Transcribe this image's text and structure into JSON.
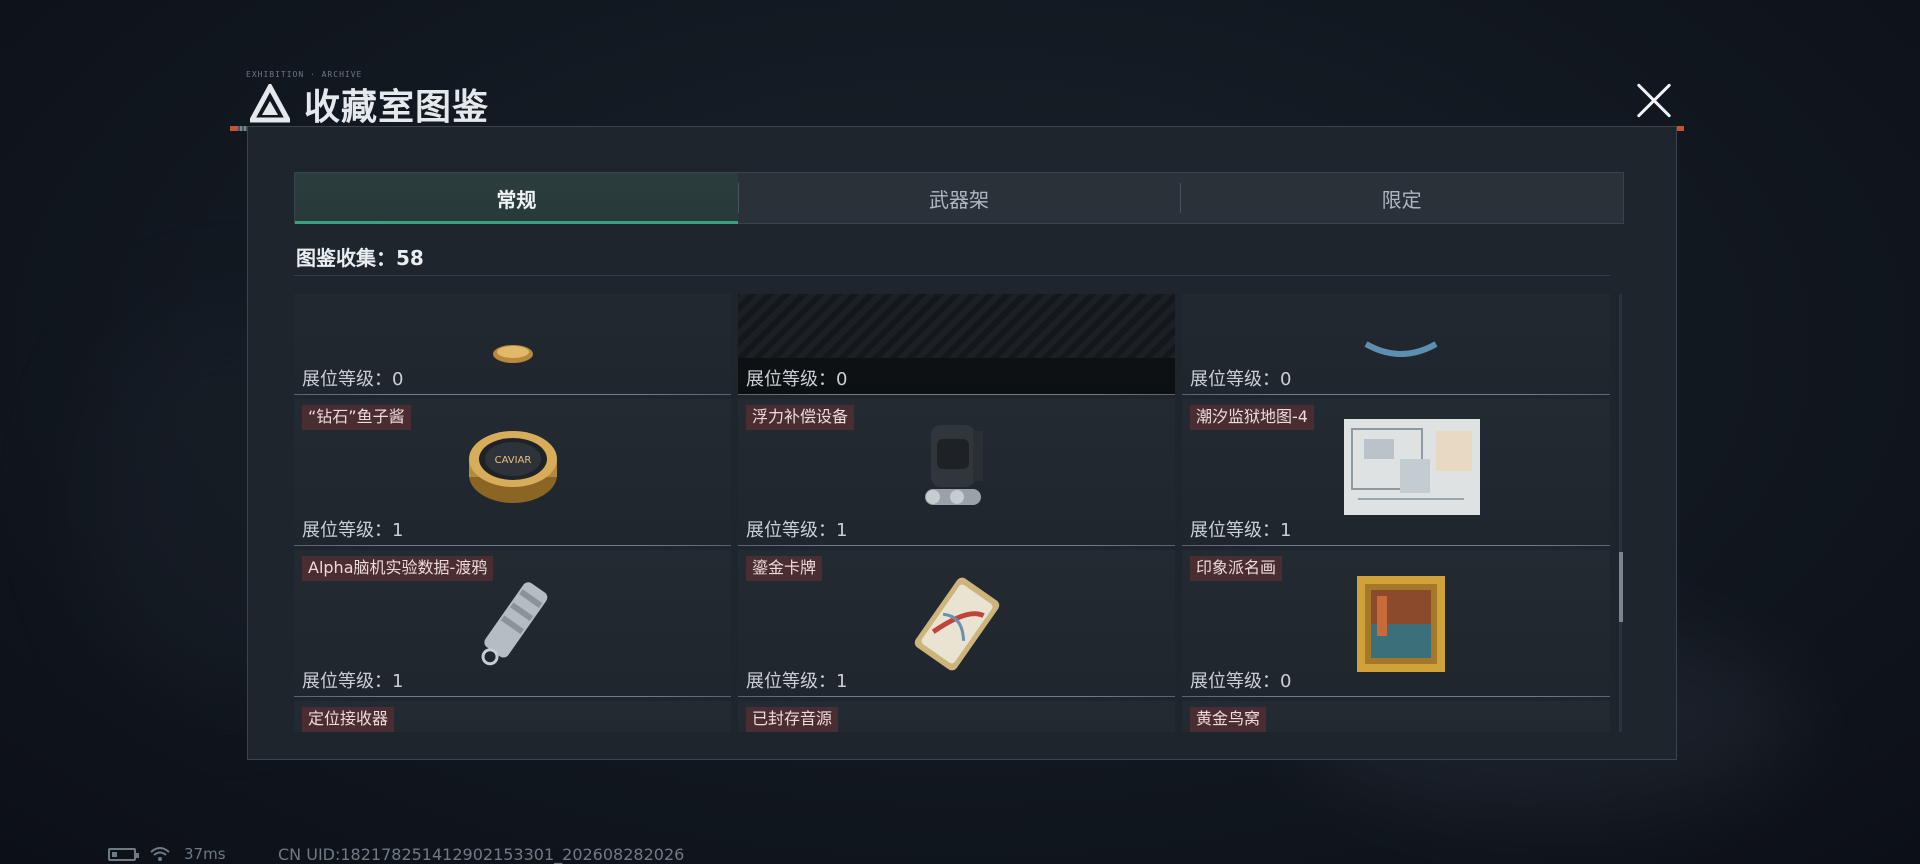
{
  "header": {
    "title": "收藏室图鉴",
    "close_label": "×"
  },
  "tabs": [
    {
      "label": "常规",
      "active": true
    },
    {
      "label": "武器架",
      "active": false
    },
    {
      "label": "限定",
      "active": false
    }
  ],
  "collection": {
    "label": "图鉴收集：",
    "count": "58"
  },
  "items": [
    {
      "name": "",
      "level_label": "展位等级：0",
      "icon": "gold-coin-icon"
    },
    {
      "name": "",
      "level_label": "展位等级：0",
      "icon": "dark-case-icon"
    },
    {
      "name": "",
      "level_label": "展位等级：0",
      "icon": "blue-ribbon-icon"
    },
    {
      "name": "“钻石”鱼子酱",
      "level_label": "展位等级：1",
      "icon": "caviar-tin-icon"
    },
    {
      "name": "浮力补偿设备",
      "level_label": "展位等级：1",
      "icon": "buoyancy-device-icon"
    },
    {
      "name": "潮汐监狱地图-4",
      "level_label": "展位等级：1",
      "icon": "prison-map-icon"
    },
    {
      "name": "Alpha脑机实验数据-渡鸦",
      "level_label": "展位等级：1",
      "icon": "data-cylinder-icon"
    },
    {
      "name": "鎏金卡牌",
      "level_label": "展位等级：1",
      "icon": "gilded-card-icon"
    },
    {
      "name": "印象派名画",
      "level_label": "展位等级：0",
      "icon": "framed-painting-icon"
    },
    {
      "name": "定位接收器",
      "level_label": "",
      "icon": "locator-receiver-icon"
    },
    {
      "name": "已封存音源",
      "level_label": "",
      "icon": "reel-recorder-icon"
    },
    {
      "name": "黄金鸟窝",
      "level_label": "",
      "icon": "golden-nest-icon"
    }
  ],
  "status_bar": {
    "ping": "37ms",
    "uid": "CN UID:18217825141290215330​1_202608282026"
  },
  "colors": {
    "active_tab_underline": "#3fa07f",
    "name_tag_bg": "#4a2d30",
    "accent_orange": "#c2542e"
  }
}
